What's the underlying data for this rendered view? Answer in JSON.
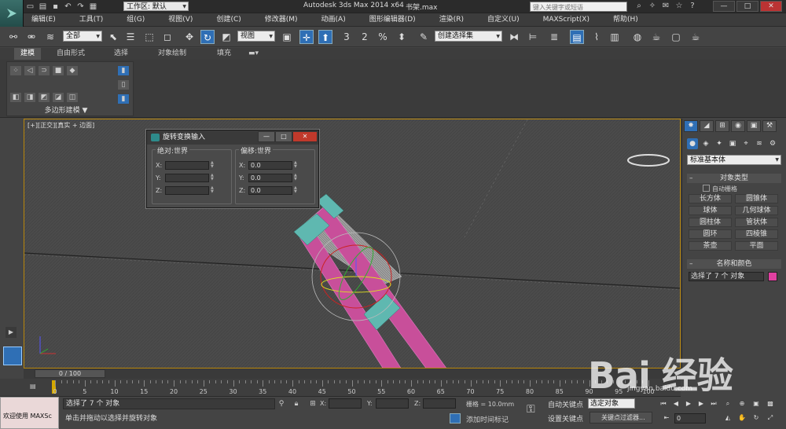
{
  "app": {
    "title": "Autodesk 3ds Max  2014 x64",
    "file": "书架.max",
    "workspace": "工作区: 默认",
    "search_placeholder": "键入关键字或短语"
  },
  "menu": [
    "编辑(E)",
    "工具(T)",
    "组(G)",
    "视图(V)",
    "创建(C)",
    "修改器(M)",
    "动画(A)",
    "图形编辑器(D)",
    "渲染(R)",
    "自定义(U)",
    "MAXScript(X)",
    "帮助(H)"
  ],
  "window_controls": {
    "minimize": "—",
    "maximize": "□",
    "close": "✕"
  },
  "toolbar": {
    "selection_filter": "全部",
    "coord_system": "视图",
    "named_selection": "创建选择集",
    "snap_label": "3",
    "angle_snap_label": "2"
  },
  "ribbon": {
    "tabs": [
      "建模",
      "自由形式",
      "选择",
      "对象绘制",
      "填充"
    ],
    "panel_label": "多边形建模 ▼"
  },
  "viewport": {
    "label": "[+][正交][真实 + 边面]"
  },
  "dialog": {
    "title": "旋转变换输入",
    "absolute_group": "绝对:世界",
    "offset_group": "偏移:世界",
    "absolute": [
      {
        "axis": "X:",
        "value": ""
      },
      {
        "axis": "Y:",
        "value": ""
      },
      {
        "axis": "Z:",
        "value": ""
      }
    ],
    "offset": [
      {
        "axis": "X:",
        "value": "0.0"
      },
      {
        "axis": "Y:",
        "value": "0.0"
      },
      {
        "axis": "Z:",
        "value": "0.0"
      }
    ],
    "btn_min": "—",
    "btn_max": "□",
    "btn_close": "✕"
  },
  "command_panel": {
    "dropdown": "标准基本体",
    "object_type_header": "对象类型",
    "autogrid": "自动栅格",
    "objects": [
      "长方体",
      "圆锥体",
      "球体",
      "几何球体",
      "圆柱体",
      "管状体",
      "圆环",
      "四棱锥",
      "茶壶",
      "平面"
    ],
    "name_color_header": "名称和颜色",
    "name_value": "选择了 7 个 对象",
    "swatch_color": "#e040a0"
  },
  "timeline": {
    "slider": "0 / 100",
    "ticks": [
      "0",
      "5",
      "10",
      "15",
      "20",
      "25",
      "30",
      "35",
      "40",
      "45",
      "50",
      "55",
      "60",
      "65",
      "70",
      "75",
      "80",
      "85",
      "90",
      "95",
      "100"
    ]
  },
  "status": {
    "maxscript": "欢迎使用 MAXSc",
    "line1": "选择了 7 个 对象",
    "line2": "单击并拖动以选择并旋转对象",
    "x_label": "X:",
    "y_label": "Y:",
    "z_label": "Z:",
    "grid": "栅格 = 10.0mm",
    "add_time_tag": "添加时间标记",
    "auto_key": "自动关键点",
    "set_key": "设置关键点",
    "selected": "选定对象",
    "key_filter": "关键点过滤器...",
    "frame": "0"
  },
  "watermark": {
    "text": "Bai 经验",
    "sub": "jingyan.baidu.com"
  }
}
